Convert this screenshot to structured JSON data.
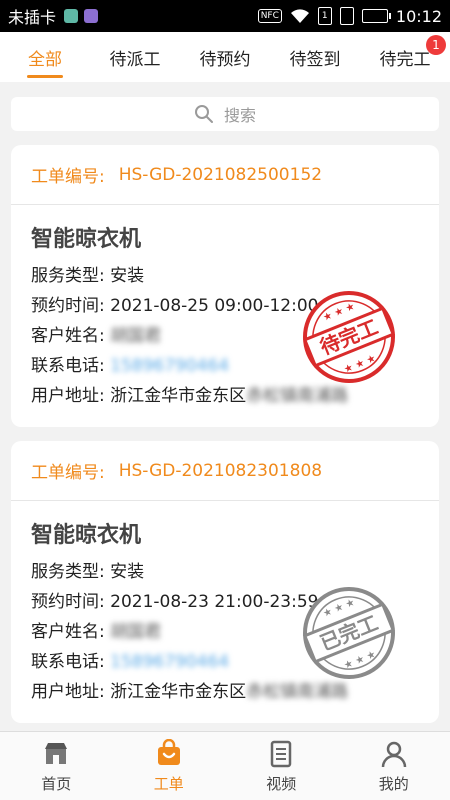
{
  "status_bar": {
    "carrier": "未插卡",
    "nfc": "NFC",
    "sim1": "1",
    "time": "10:12",
    "colors": {
      "app1": "#5fb8a6",
      "app2": "#8c6fd1",
      "battery": "#3bd13b"
    }
  },
  "tabs": [
    {
      "label": "全部",
      "active": true
    },
    {
      "label": "待派工"
    },
    {
      "label": "待预约"
    },
    {
      "label": "待签到"
    },
    {
      "label": "待完工",
      "badge": "1"
    }
  ],
  "search": {
    "placeholder": "搜索",
    "icon": "search-icon"
  },
  "orders": [
    {
      "order_label": "工单编号:",
      "order_no": "HS-GD-2021082500152",
      "product": "智能晾衣机",
      "service_label": "服务类型:",
      "service": "安装",
      "time_label": "预约时间:",
      "time": "2021-08-25 09:00-12:00",
      "customer_label": "客户姓名:",
      "customer": "胡国君",
      "phone_label": "联系电话:",
      "phone": "15896790464",
      "address_label": "用户地址:",
      "address": "浙江金华市金东区",
      "address_blur": "赤松镇南浦路",
      "stamp": {
        "text": "待完工",
        "color": "#d92b2b"
      }
    },
    {
      "order_label": "工单编号:",
      "order_no": "HS-GD-2021082301808",
      "product": "智能晾衣机",
      "service_label": "服务类型:",
      "service": "安装",
      "time_label": "预约时间:",
      "time": "2021-08-23 21:00-23:59",
      "customer_label": "客户姓名:",
      "customer": "胡国君",
      "phone_label": "联系电话:",
      "phone": "15896790464",
      "address_label": "用户地址:",
      "address": "浙江金华市金东区",
      "address_blur": "赤松镇南浦路",
      "stamp": {
        "text": "已完工",
        "color": "#8a8a8a"
      }
    }
  ],
  "bottom_nav": [
    {
      "label": "首页",
      "icon": "home-store-icon"
    },
    {
      "label": "工单",
      "icon": "order-bag-icon",
      "active": true
    },
    {
      "label": "视频",
      "icon": "video-doc-icon"
    },
    {
      "label": "我的",
      "icon": "profile-icon"
    }
  ],
  "colors": {
    "accent": "#f08a1c",
    "badge": "#ee3b3b",
    "phone": "#5aa9e6"
  }
}
